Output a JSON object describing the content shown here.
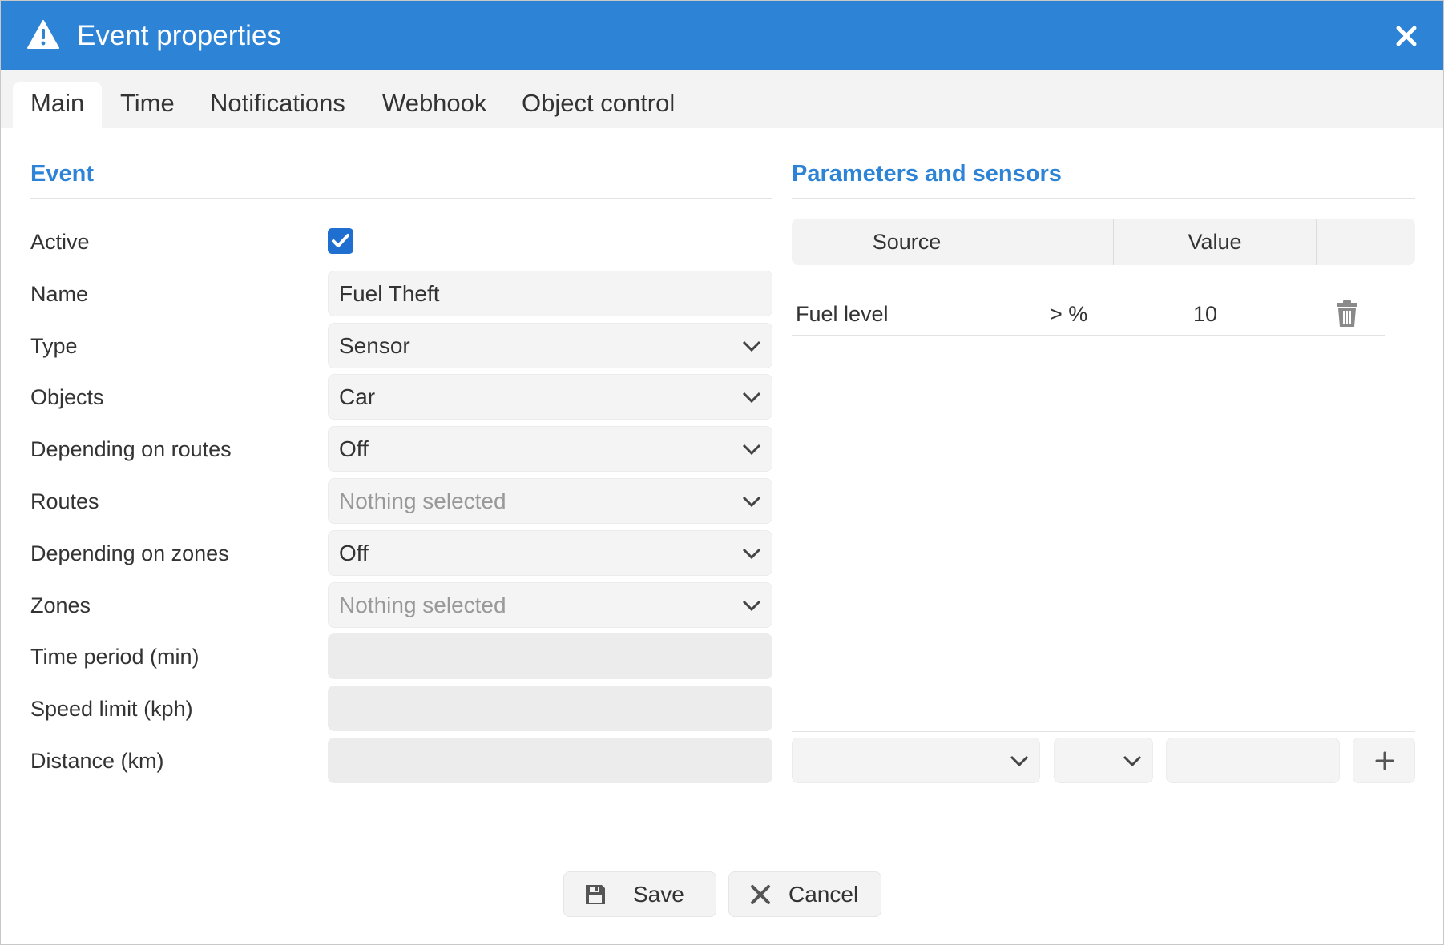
{
  "dialog": {
    "title": "Event properties"
  },
  "tabs": [
    {
      "label": "Main",
      "active": true
    },
    {
      "label": "Time"
    },
    {
      "label": "Notifications"
    },
    {
      "label": "Webhook"
    },
    {
      "label": "Object control"
    }
  ],
  "event_section": {
    "title": "Event",
    "active_label": "Active",
    "active_checked": true,
    "name_label": "Name",
    "name_value": "Fuel Theft",
    "type_label": "Type",
    "type_value": "Sensor",
    "objects_label": "Objects",
    "objects_value": "Car",
    "dep_routes_label": "Depending on routes",
    "dep_routes_value": "Off",
    "routes_label": "Routes",
    "routes_placeholder": "Nothing selected",
    "dep_zones_label": "Depending on zones",
    "dep_zones_value": "Off",
    "zones_label": "Zones",
    "zones_placeholder": "Nothing selected",
    "time_period_label": "Time period (min)",
    "time_period_value": "",
    "speed_limit_label": "Speed limit (kph)",
    "speed_limit_value": "",
    "distance_label": "Distance (km)",
    "distance_value": ""
  },
  "params_section": {
    "title": "Parameters and sensors",
    "columns": [
      "Source",
      "",
      "Value",
      ""
    ],
    "rows": [
      {
        "source": "Fuel level",
        "condition": "> %",
        "value": "10"
      }
    ]
  },
  "footer": {
    "save_label": "Save",
    "cancel_label": "Cancel"
  },
  "colors": {
    "accent": "#2d83d6",
    "checkbox": "#1f6fd0"
  }
}
